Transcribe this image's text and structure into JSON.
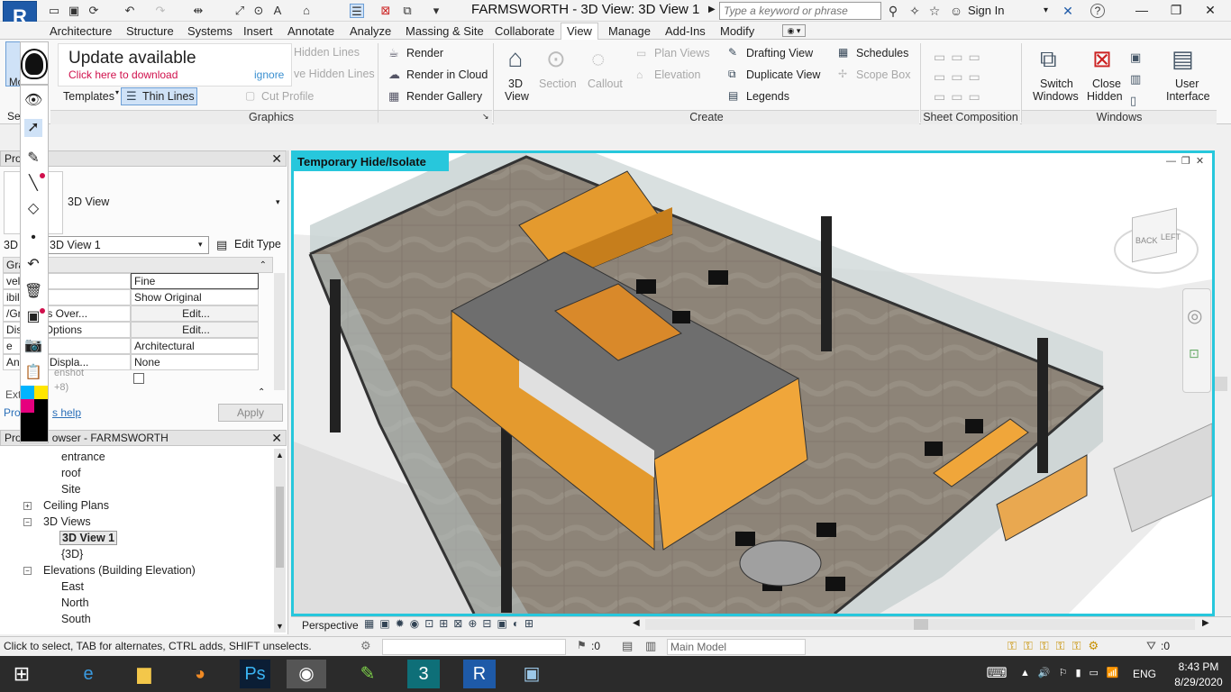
{
  "window": {
    "title": "FARMSWORTH - 3D View: 3D View 1"
  },
  "app_logo": "R",
  "search": {
    "placeholder": "Type a keyword or phrase"
  },
  "account": {
    "signin_label": "Sign In"
  },
  "tabs": [
    "Architecture",
    "Structure",
    "Systems",
    "Insert",
    "Annotate",
    "Analyze",
    "Massing & Site",
    "Collaborate",
    "View",
    "Manage",
    "Add-Ins",
    "Modify"
  ],
  "active_tab": "View",
  "ribbon": {
    "update_title": "Update available",
    "update_link": "Click here to download",
    "ignore_label": "ignore",
    "modify_label": "Modify",
    "select_label": "Se",
    "hidden_lines_1": "Hidden Lines",
    "hidden_lines_2": "ve Hidden Lines",
    "templates": "Templates",
    "thin_lines": "Thin Lines",
    "cut_profile": "Cut Profile",
    "graphics_title": "Graphics",
    "render": "Render",
    "render_cloud": "Render  in Cloud",
    "render_gallery": "Render  Gallery",
    "view_3d": "3D",
    "view_3d_2": "View",
    "section": "Section",
    "callout": "Callout",
    "plan_views": "Plan  Views",
    "elevation": "Elevation",
    "drafting_view": "Drafting  View",
    "duplicate_view": "Duplicate  View",
    "legends": "Legends",
    "schedules": "Schedules",
    "scope_box": "Scope  Box",
    "create_title": "Create",
    "sheet_comp_title": "Sheet Composition",
    "switch_windows_1": "Switch",
    "switch_windows_2": "Windows",
    "close_hidden_1": "Close",
    "close_hidden_2": "Hidden",
    "user_interface_1": "User",
    "user_interface_2": "Interface",
    "windows_title": "Windows"
  },
  "properties": {
    "header": "Pro",
    "type_name": "3D View",
    "instance_select": "3D View 1",
    "instance_prefix": "3D",
    "edit_type": "Edit Type",
    "group": "Gra",
    "rows": [
      {
        "name": "vel",
        "value": "Fine"
      },
      {
        "name": "ibility",
        "value": "Show Original"
      },
      {
        "name": "/Graphics Over...",
        "value": "Edit..."
      },
      {
        "name": "Display Options",
        "value": "Edit..."
      },
      {
        "name": "e",
        "value": "Architectural"
      },
      {
        "name": "Analysis Displa...",
        "value": "None"
      }
    ],
    "screenshot_hint": "enshot",
    "screenshot_hint2": "+8)",
    "ext": "Ext",
    "help_link": "s help",
    "help_prefix": "Pro",
    "apply": "Apply"
  },
  "browser": {
    "header": "owser - FARMSWORTH",
    "header_prefix": "Pro",
    "items": [
      {
        "label": "entrance",
        "indent": 3
      },
      {
        "label": "roof",
        "indent": 3
      },
      {
        "label": "Site",
        "indent": 3
      },
      {
        "label": "Ceiling Plans",
        "indent": 2,
        "toggle": "+"
      },
      {
        "label": "3D Views",
        "indent": 2,
        "toggle": "−"
      },
      {
        "label": "3D View 1",
        "indent": 3,
        "bold": true
      },
      {
        "label": "{3D}",
        "indent": 3
      },
      {
        "label": "Elevations (Building Elevation)",
        "indent": 2,
        "toggle": "−"
      },
      {
        "label": "East",
        "indent": 3
      },
      {
        "label": "North",
        "indent": 3
      },
      {
        "label": "South",
        "indent": 3
      }
    ]
  },
  "viewport": {
    "mode_label": "Temporary Hide/Isolate",
    "cube_back": "BACK",
    "cube_left": "LEFT"
  },
  "view_control": {
    "projection": "Perspective"
  },
  "status": {
    "hint": "Click to select, TAB for alternates, CTRL adds, SHIFT unselects.",
    "count": ":0",
    "model": "Main Model",
    "filter_count": ":0"
  },
  "taskbar": {
    "lang": "ENG",
    "time": "8:43 PM",
    "date": "8/29/2020"
  },
  "colors": {
    "accent": "#27c7dc",
    "brand": "#1e5aa8",
    "link": "#d0104c"
  }
}
